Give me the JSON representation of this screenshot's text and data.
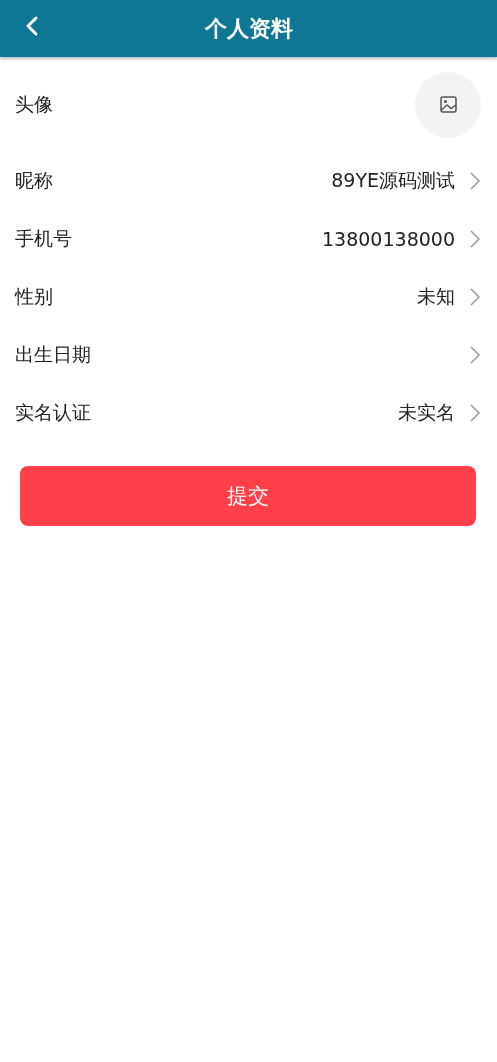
{
  "header": {
    "title": "个人资料"
  },
  "rows": [
    {
      "kind": "avatar",
      "label": "头像"
    },
    {
      "kind": "link",
      "label": "昵称",
      "value": "89YE源码测试"
    },
    {
      "kind": "link",
      "label": "手机号",
      "value": "13800138000"
    },
    {
      "kind": "link",
      "label": "性别",
      "value": "未知"
    },
    {
      "kind": "link",
      "label": "出生日期"
    },
    {
      "kind": "link",
      "label": "实名认证",
      "value": "未实名"
    }
  ],
  "submit": "提交"
}
